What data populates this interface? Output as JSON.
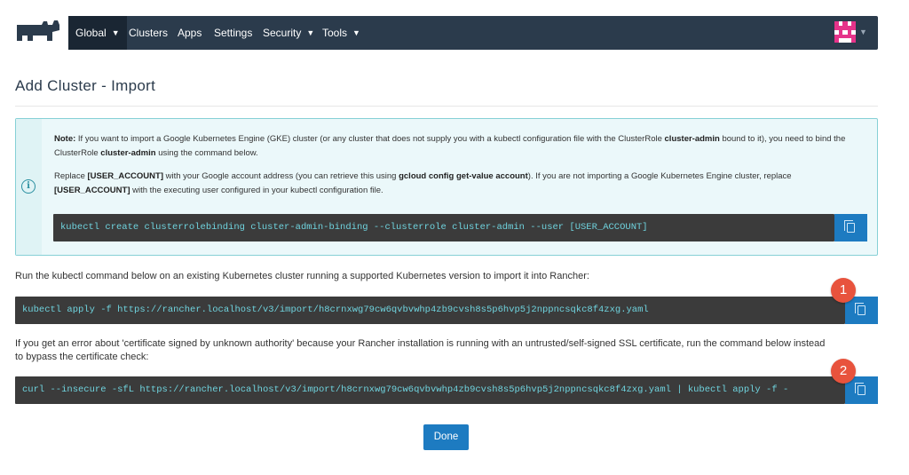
{
  "nav": {
    "items": [
      {
        "label": "Global",
        "has_dropdown": true
      },
      {
        "label": "Clusters",
        "has_dropdown": false
      },
      {
        "label": "Apps",
        "has_dropdown": false
      },
      {
        "label": "Settings",
        "has_dropdown": false
      },
      {
        "label": "Security",
        "has_dropdown": true
      },
      {
        "label": "Tools",
        "has_dropdown": true
      }
    ],
    "chevron": "⌄",
    "colors": {
      "bar": "#2b3b4c",
      "active": "#1a2633",
      "logo": "#2b3b4c"
    }
  },
  "page": {
    "title": "Add Cluster - Import"
  },
  "note": {
    "icon": "info-circle-icon",
    "p1_label": "Note:",
    "p1_a": " If you want to import a Google Kubernetes Engine (GKE) cluster (or any cluster that does not supply you with a kubectl configuration file with the ClusterRole ",
    "p1_bold1": "cluster-admin",
    "p1_b": " bound to it), you need to bind the ClusterRole ",
    "p1_bold2": "cluster-admin",
    "p1_c": " using the command below.",
    "p2_a": "Replace ",
    "p2_bold1": "[USER_ACCOUNT]",
    "p2_b": " with your Google account address (you can retrieve this using ",
    "p2_bold2": "gcloud config get-value account",
    "p2_c": "). If you are not importing a Google Kubernetes Engine cluster, replace ",
    "p2_bold3": "[USER_ACCOUNT]",
    "p2_d": " with the executing user configured in your kubectl configuration file.",
    "command": "kubectl create clusterrolebinding cluster-admin-binding --clusterrole cluster-admin --user [USER_ACCOUNT]"
  },
  "import": {
    "instruction": "Run the kubectl command below on an existing Kubernetes cluster running a supported Kubernetes version to import it into Rancher:",
    "command": "kubectl apply -f https://rancher.localhost/v3/import/h8crnxwg79cw6qvbvwhp4zb9cvsh8s5p6hvp5j2nppncsqkc8f4zxg.yaml",
    "insecure_instruction": "If you get an error about 'certificate signed by unknown authority' because your Rancher installation is running with an untrusted/self-signed SSL certificate, run the command below instead to bypass the certificate check:",
    "insecure_command": "curl --insecure -sfL https://rancher.localhost/v3/import/h8crnxwg79cw6qvbvwhp4zb9cvsh8s5p6hvp5j2nppncsqkc8f4zxg.yaml | kubectl apply -f -"
  },
  "badges": {
    "one": "1",
    "two": "2",
    "color": "#e8533d"
  },
  "actions": {
    "done_label": "Done"
  },
  "colors": {
    "accent": "#1d7bc1",
    "code_bg": "#3b3b3b",
    "code_text": "#6fd3de",
    "info_bg": "#ebf8fa",
    "info_border": "#86d0d6"
  }
}
